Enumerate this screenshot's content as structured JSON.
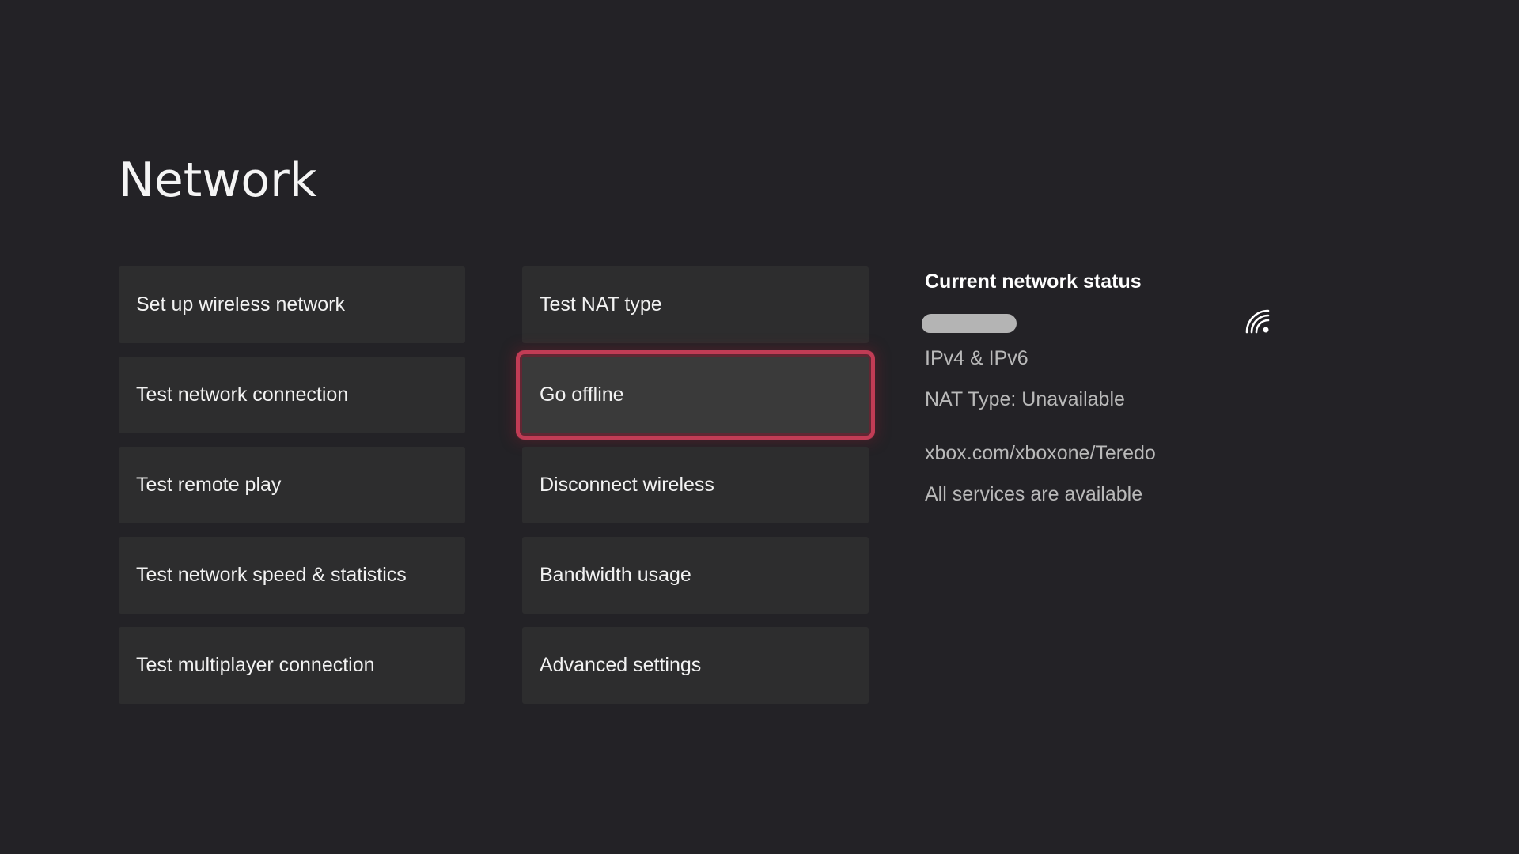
{
  "header": {
    "title": "Network"
  },
  "menu": {
    "column1": [
      {
        "label": "Set up wireless network"
      },
      {
        "label": "Test network connection"
      },
      {
        "label": "Test remote play"
      },
      {
        "label": "Test network speed & statistics"
      },
      {
        "label": "Test multiplayer connection"
      }
    ],
    "column2": [
      {
        "label": "Test NAT type"
      },
      {
        "label": "Go offline",
        "focused": true
      },
      {
        "label": "Disconnect wireless"
      },
      {
        "label": "Bandwidth usage"
      },
      {
        "label": "Advanced settings"
      }
    ]
  },
  "status": {
    "title": "Current network status",
    "network_name": "[redacted]",
    "signal_icon": "wifi-signal-icon",
    "ip_version": "IPv4 & IPv6",
    "nat_type": "NAT Type: Unavailable",
    "teredo_link": "xbox.com/xboxone/Teredo",
    "services": "All services are available"
  },
  "colors": {
    "background": "#232226",
    "tile": "#2d2d2e",
    "focus_outline": "#c13c55",
    "secondary_text": "#b9b9b9"
  }
}
